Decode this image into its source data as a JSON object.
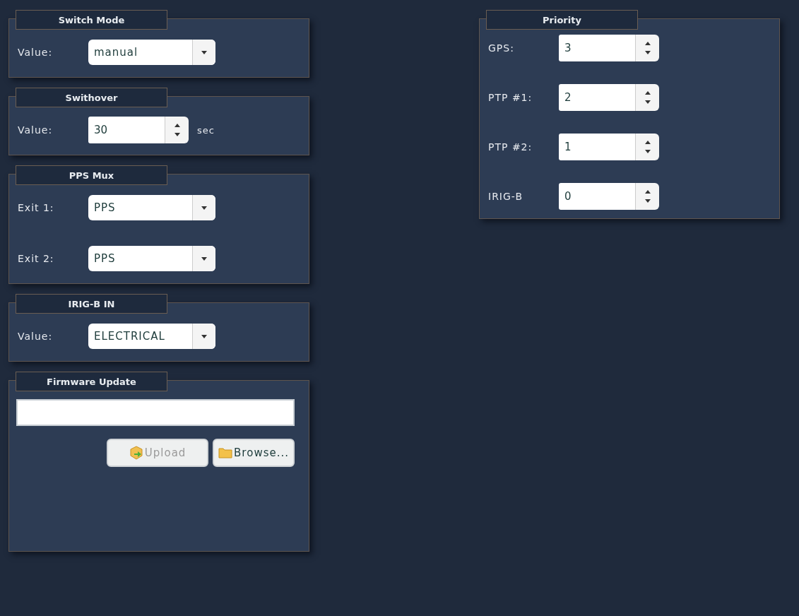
{
  "left_panels": [
    {
      "kind": "fields",
      "title": "Switch Mode",
      "rows": [
        {
          "kind": "select",
          "label": "Value:",
          "value": "manual"
        }
      ]
    },
    {
      "kind": "fields",
      "title": "Swithover",
      "rows": [
        {
          "kind": "spin",
          "label": "Value:",
          "value": "30",
          "unit": "sec"
        }
      ]
    },
    {
      "kind": "fields",
      "title": "PPS Mux",
      "rows": [
        {
          "kind": "select",
          "label": "Exit 1:",
          "value": "PPS"
        },
        {
          "kind": "select",
          "label": "Exit 2:",
          "value": "PPS"
        }
      ]
    },
    {
      "kind": "fields",
      "title": "IRIG-B IN",
      "rows": [
        {
          "kind": "select",
          "label": "Value:",
          "value": "ELECTRICAL"
        }
      ]
    },
    {
      "kind": "firmware",
      "title": "Firmware Update",
      "buttons": [
        {
          "kind": "upload",
          "label": "Upload",
          "disabled": true
        },
        {
          "kind": "browse",
          "label": "Browse...",
          "disabled": false
        }
      ]
    }
  ],
  "priority": {
    "title": "Priority",
    "rows": [
      {
        "kind": "spin",
        "label": "GPS:",
        "value": "3"
      },
      {
        "kind": "spin",
        "label": "PTP #1:",
        "value": "2"
      },
      {
        "kind": "spin",
        "label": "PTP #2:",
        "value": "1"
      },
      {
        "kind": "spin",
        "label": "IRIG-B",
        "value": "0"
      }
    ]
  }
}
